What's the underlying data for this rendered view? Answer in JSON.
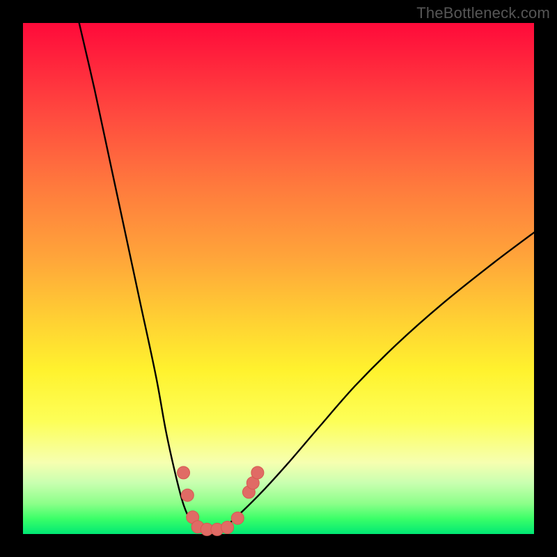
{
  "watermark": "TheBottleneck.com",
  "colors": {
    "frame": "#000000",
    "curve": "#000000",
    "marker_fill": "#e06b65",
    "marker_stroke": "#d65951"
  },
  "chart_data": {
    "type": "line",
    "title": "",
    "xlabel": "",
    "ylabel": "",
    "xlim": [
      0,
      100
    ],
    "ylim": [
      0,
      100
    ],
    "grid": false,
    "series": [
      {
        "name": "bottleneck-curve",
        "x": [
          11,
          14,
          17,
          20,
          23,
          26,
          28,
          30,
          31.5,
          33,
          34.5,
          36,
          38,
          40,
          43,
          47,
          52,
          58,
          65,
          73,
          82,
          92,
          100
        ],
        "values": [
          100,
          87,
          73,
          59,
          45,
          31,
          20,
          11,
          5.5,
          2.3,
          0.9,
          0.4,
          0.6,
          1.8,
          4.5,
          8.5,
          14,
          21,
          29,
          37,
          45,
          53,
          59
        ]
      }
    ],
    "markers": [
      {
        "x": 31.4,
        "y": 12.0
      },
      {
        "x": 32.2,
        "y": 7.6
      },
      {
        "x": 33.2,
        "y": 3.3
      },
      {
        "x": 34.2,
        "y": 1.4
      },
      {
        "x": 36.0,
        "y": 0.9
      },
      {
        "x": 38.0,
        "y": 0.9
      },
      {
        "x": 40.0,
        "y": 1.3
      },
      {
        "x": 42.0,
        "y": 3.1
      },
      {
        "x": 44.2,
        "y": 8.2
      },
      {
        "x": 45.0,
        "y": 10.0
      },
      {
        "x": 45.9,
        "y": 12.0
      }
    ]
  }
}
